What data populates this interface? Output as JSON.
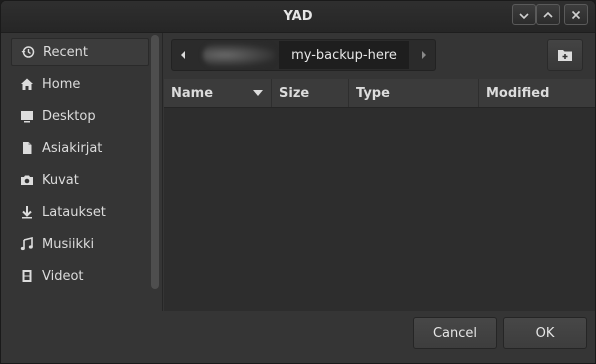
{
  "window": {
    "title": "YAD"
  },
  "sidebar": {
    "items": [
      {
        "label": "Recent",
        "icon": "recent-icon"
      },
      {
        "label": "Home",
        "icon": "home-icon"
      },
      {
        "label": "Desktop",
        "icon": "desktop-icon"
      },
      {
        "label": "Asiakirjat",
        "icon": "document-icon"
      },
      {
        "label": "Kuvat",
        "icon": "camera-icon"
      },
      {
        "label": "Lataukset",
        "icon": "download-icon"
      },
      {
        "label": "Musiikki",
        "icon": "music-icon"
      },
      {
        "label": "Videot",
        "icon": "video-icon"
      }
    ]
  },
  "pathbar": {
    "current": "my-backup-here"
  },
  "filelist": {
    "columns": [
      "Name",
      "Size",
      "Type",
      "Modified"
    ]
  },
  "buttons": {
    "cancel": "Cancel",
    "ok": "OK"
  },
  "colors": {
    "background": "#353535",
    "list_background": "#2d2d2d",
    "text": "#dcdcdc"
  }
}
